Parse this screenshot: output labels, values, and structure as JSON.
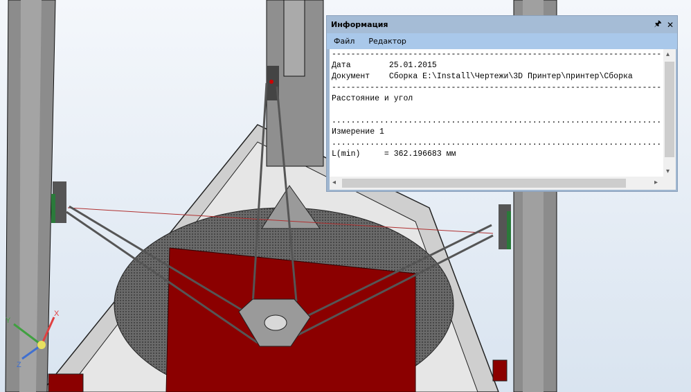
{
  "viewport": {
    "axes": {
      "x": "X",
      "y": "Y",
      "z": "Z"
    },
    "colors": {
      "plate": "#8b0000",
      "frame": "#8c8c8c",
      "background": "#e8eef5"
    }
  },
  "panel": {
    "title": "Информация",
    "pin_icon": "pin-icon",
    "close_icon": "close-icon",
    "menu": [
      "Файл",
      "Редактор"
    ],
    "lines": [
      "--------------------------------------------------------------------------------",
      "Дата        25.01.2015",
      "Документ    Сборка E:\\Install\\Чертежи\\3D Принтер\\принтер\\Сборка",
      "--------------------------------------------------------------------------------",
      "Расстояние и угол",
      "",
      "................................................................................",
      "Измерение 1",
      "................................................................................",
      "L(min)     = 362.196683 мм"
    ]
  }
}
